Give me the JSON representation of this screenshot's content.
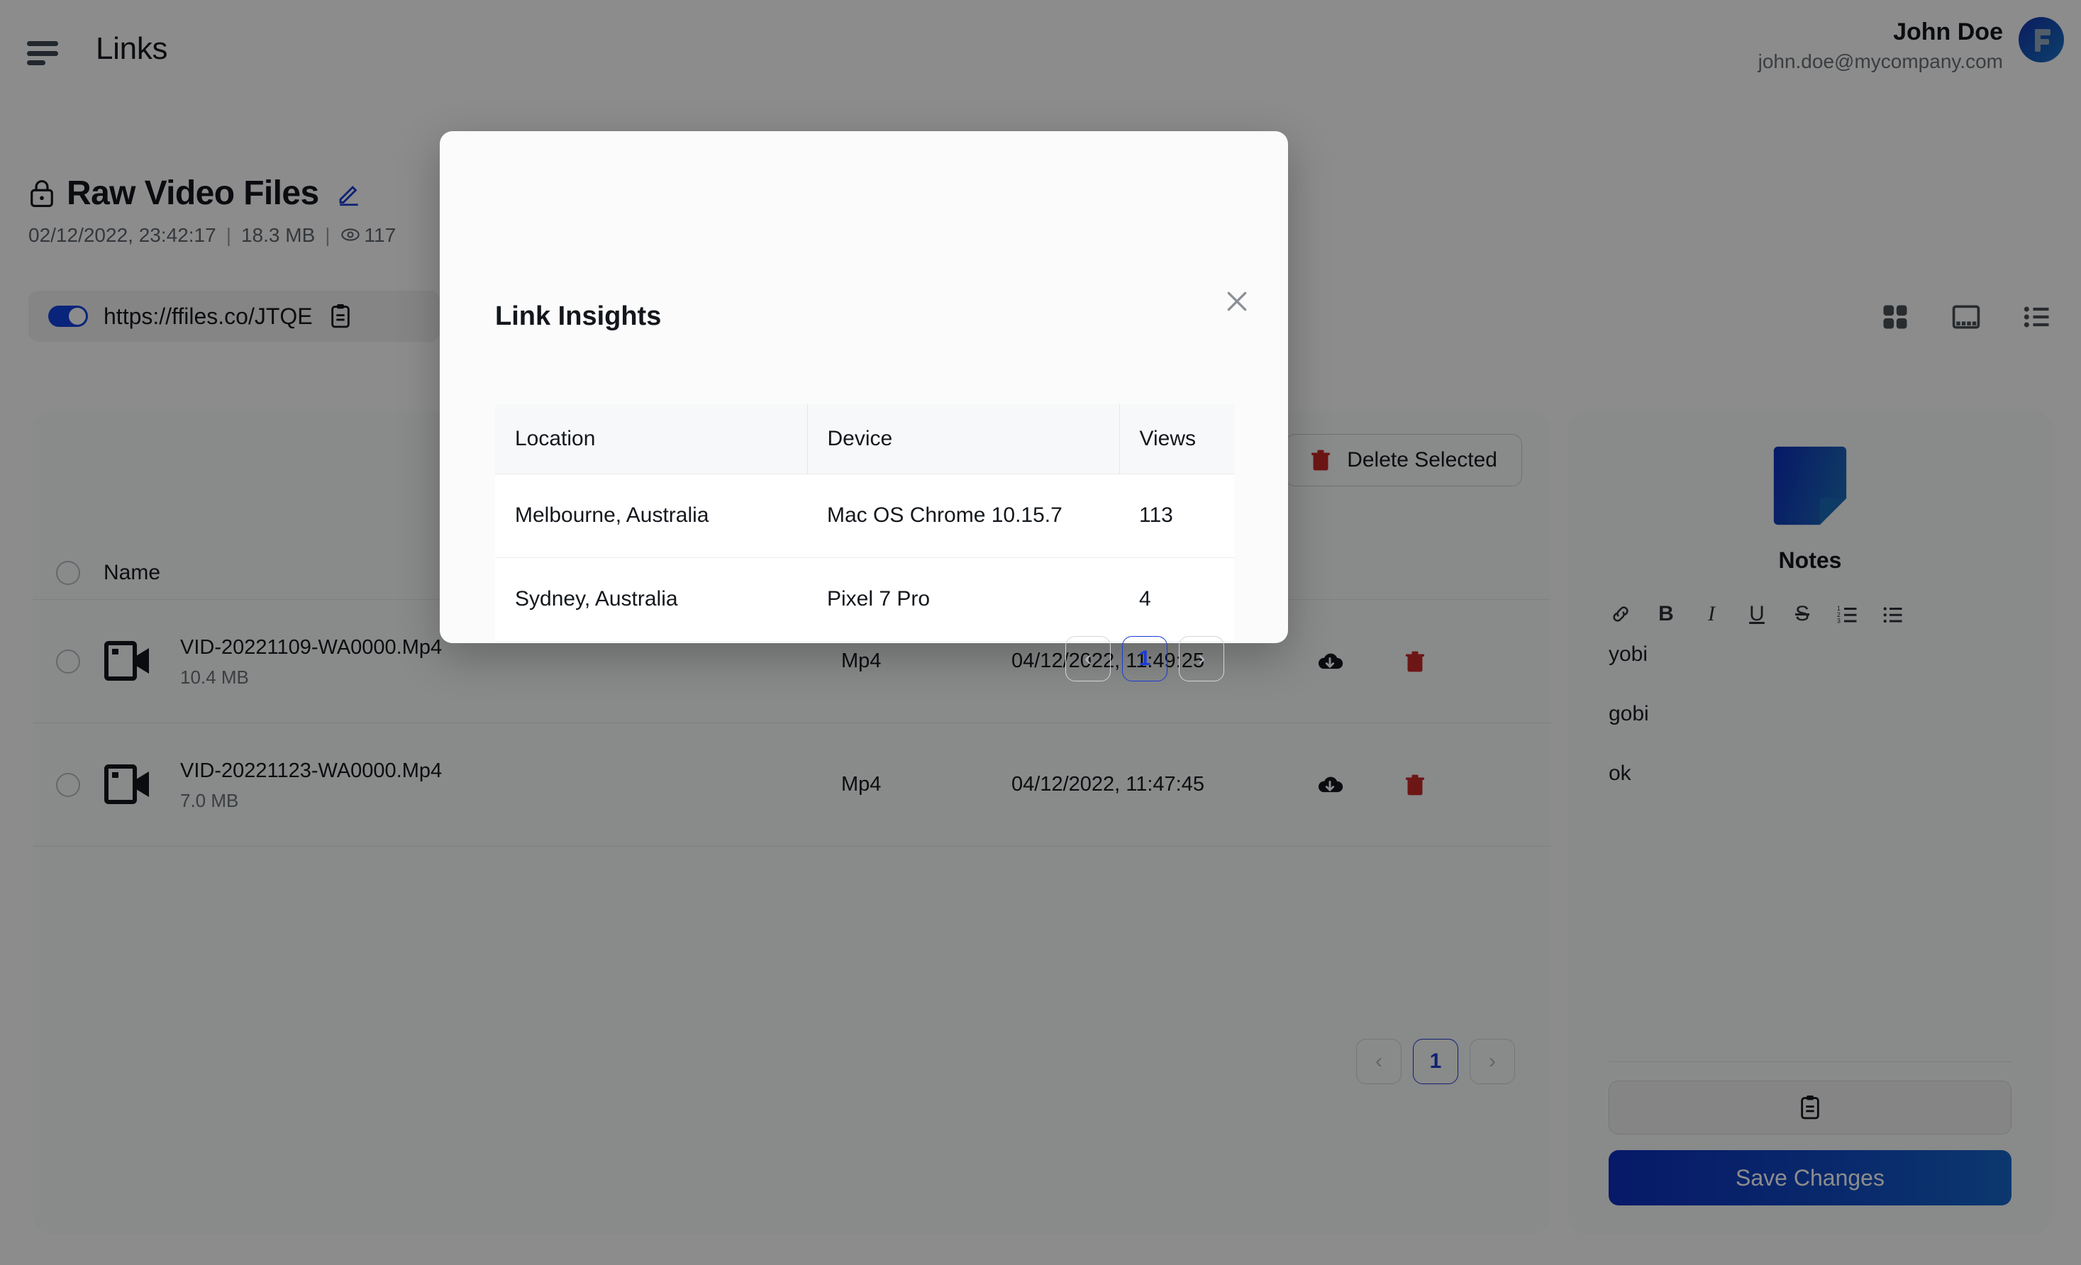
{
  "header": {
    "menu_icon": "hamburger-icon",
    "title": "Links",
    "user_name": "John Doe",
    "user_email": "john.doe@mycompany.com",
    "avatar_icon": "brand-f-logo"
  },
  "file_header": {
    "lock_icon": "lock-icon",
    "title": "Raw Video Files",
    "edit_icon": "pencil-edit-icon",
    "date": "02/12/2022, 23:42:17",
    "separator": "|",
    "size": "18.3 MB",
    "views_icon": "eye-icon",
    "views": "117",
    "link_enabled": true,
    "url": "https://ffiles.co/JTQE",
    "copy_icon": "clipboard-icon"
  },
  "view_modes": [
    {
      "name": "grid-view",
      "icon": "grid-icon"
    },
    {
      "name": "gallery-view",
      "icon": "gallery-icon"
    },
    {
      "name": "list-view",
      "icon": "list-icon"
    }
  ],
  "files_card": {
    "delete_selected_label": "Delete Selected",
    "delete_icon": "trash-icon",
    "columns": {
      "name": "Name"
    },
    "rows": [
      {
        "icon": "video-camera-icon",
        "name": "VID-20221109-WA0000.Mp4",
        "size": "10.4 MB",
        "type": "Mp4",
        "date": "04/12/2022, 11:49:25",
        "download_icon": "cloud-download-icon",
        "delete_icon": "trash-icon"
      },
      {
        "icon": "video-camera-icon",
        "name": "VID-20221123-WA0000.Mp4",
        "size": "7.0 MB",
        "type": "Mp4",
        "date": "04/12/2022, 11:47:45",
        "download_icon": "cloud-download-icon",
        "delete_icon": "trash-icon"
      }
    ],
    "pagination": {
      "prev": "‹",
      "current": "1",
      "next": "›"
    }
  },
  "notes": {
    "icon": "sticky-note-icon",
    "title": "Notes",
    "toolbar": [
      {
        "name": "link",
        "label": "⚓"
      },
      {
        "name": "bold",
        "label": "B"
      },
      {
        "name": "italic",
        "label": "I"
      },
      {
        "name": "underline",
        "label": "U"
      },
      {
        "name": "strikethrough",
        "label": "S"
      },
      {
        "name": "ordered-list",
        "label": "≡"
      },
      {
        "name": "bullet-list",
        "label": "☰"
      }
    ],
    "lines": [
      "yobi",
      "gobi",
      "ok"
    ],
    "copy_icon": "clipboard-icon",
    "save_label": "Save Changes"
  },
  "modal": {
    "title": "Link Insights",
    "close_icon": "close-icon",
    "columns": [
      "Location",
      "Device",
      "Views"
    ],
    "rows": [
      {
        "location": "Melbourne, Australia",
        "device": "Mac OS Chrome 10.15.7",
        "views": "113"
      },
      {
        "location": "Sydney, Australia",
        "device": "Pixel 7 Pro",
        "views": "4"
      }
    ],
    "pagination": {
      "prev": "‹",
      "current": "1",
      "next": "›"
    }
  },
  "colors": {
    "accent_blue": "#1142e0",
    "active_page": "#1a3cd6",
    "danger_red": "#c62828",
    "card_bg": "#fafbfc",
    "overlay": "rgba(0,0,0,0.45)"
  }
}
